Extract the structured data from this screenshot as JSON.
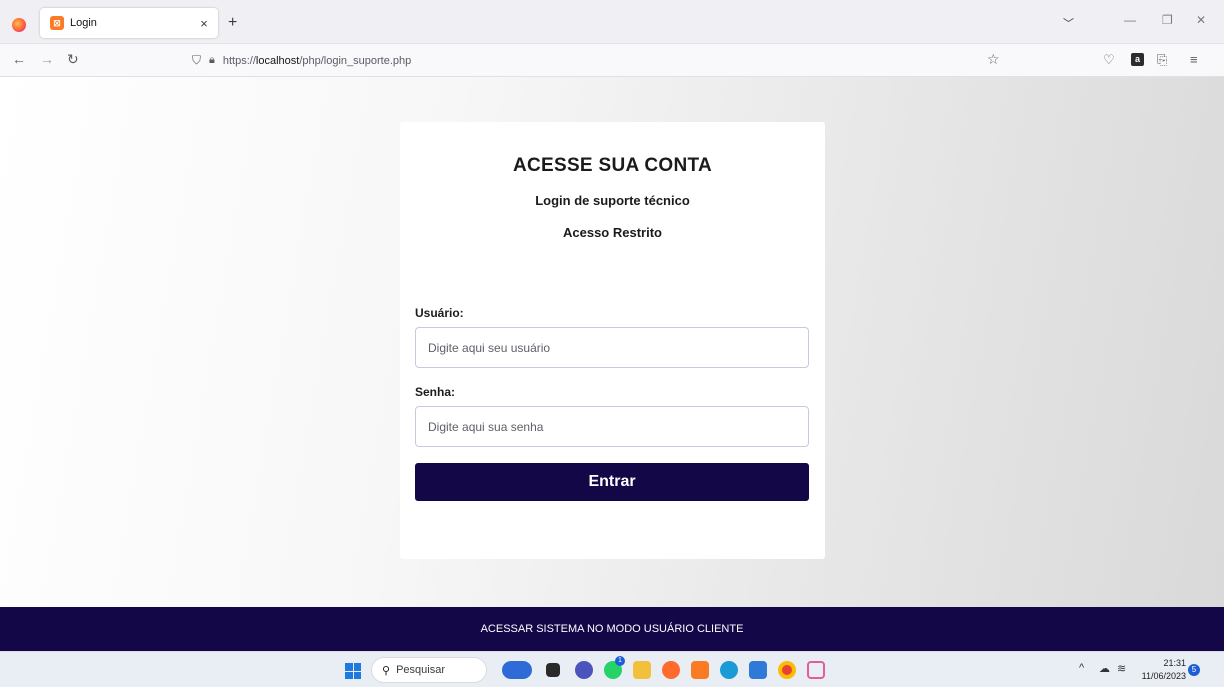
{
  "browser": {
    "tab_title": "Login",
    "tab_close": "×",
    "new_tab": "+",
    "url_prefix": "https://",
    "url_host": "localhost",
    "url_path": "/php/login_suporte.php"
  },
  "card": {
    "title": "ACESSE SUA CONTA",
    "subtitle": "Login de suporte técnico",
    "restricted": "Acesso Restrito",
    "user_label": "Usuário:",
    "user_placeholder": "Digite aqui seu usuário",
    "password_label": "Senha:",
    "password_placeholder": "Digite aqui sua senha",
    "submit_label": "Entrar"
  },
  "footer": {
    "link_text": "ACESSAR SISTEMA NO MODO USUÁRIO CLIENTE"
  },
  "taskbar": {
    "search_label": "Pesquisar",
    "time": "21:31",
    "date": "11/06/2023",
    "notification_count": "5",
    "whatsapp_badge": "1"
  },
  "colors": {
    "primary_button": "#130748",
    "footer_bg": "#130748",
    "favicon": "#fb7a24"
  },
  "icons": {
    "taskbar_apps": [
      "bing-icon",
      "app-icon",
      "teams-icon",
      "whatsapp-icon",
      "file-explorer-icon",
      "firefox-icon",
      "xampp-icon",
      "edge-icon",
      "store-icon",
      "chrome-icon",
      "snipping-tool-icon"
    ]
  }
}
